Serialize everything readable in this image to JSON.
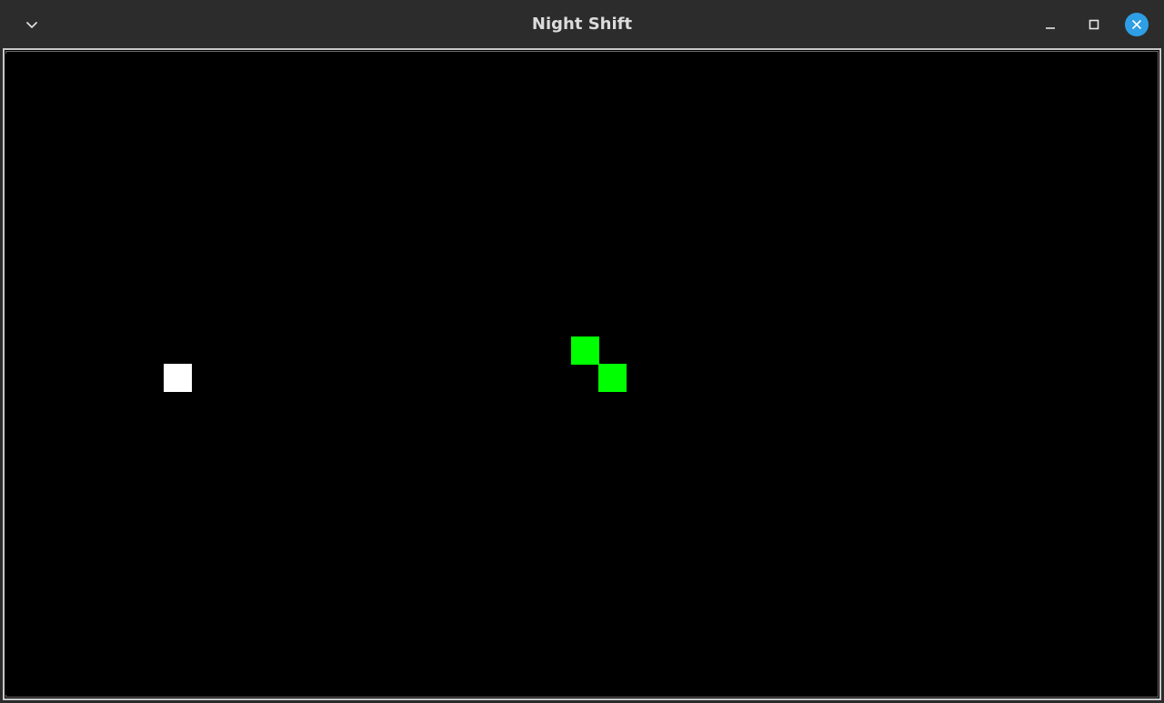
{
  "window": {
    "title": "Night Shift"
  },
  "colors": {
    "titlebar": "#2c2c2c",
    "title_text": "#dcdcdc",
    "close_button": "#2e9fe5",
    "game_background": "#000000",
    "snake": "#00ff00",
    "food": "#ffffff"
  },
  "icons": {
    "menu": "chevron-down-icon",
    "minimize": "minimize-icon",
    "maximize": "maximize-icon",
    "close": "close-icon"
  },
  "game": {
    "snake_segment_count": 2,
    "food_count": 1
  }
}
